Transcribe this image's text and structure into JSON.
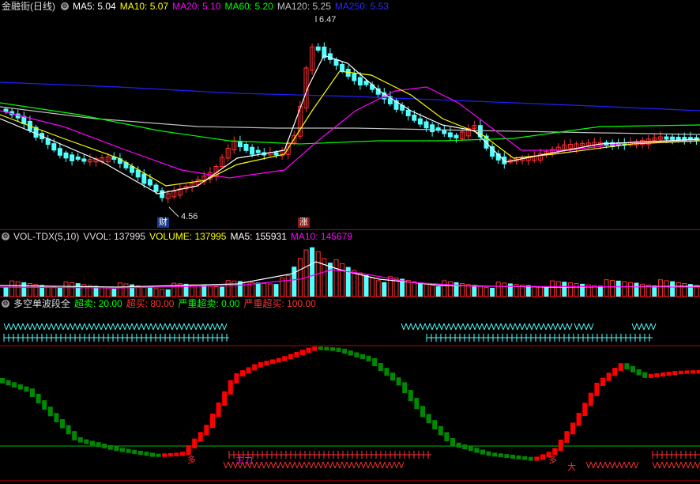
{
  "colors": {
    "up": "#ff3232",
    "down": "#54ffff",
    "ma5": "#ffffff",
    "ma10": "#ffff00",
    "ma20": "#ff00ff",
    "ma60": "#00ff00",
    "ma120": "#c0c0c0",
    "ma250": "#2020ff",
    "bull": "#ff0000",
    "bear": "#008800",
    "grid": "#c00000"
  },
  "price_pane": {
    "stock_name": "金融街(日线)",
    "ma_labels": [
      {
        "text": "MA5: 5.04",
        "color": "#ffffff"
      },
      {
        "text": "MA10: 5.07",
        "color": "#ffff00"
      },
      {
        "text": "MA20: 5.10",
        "color": "#ff00ff"
      },
      {
        "text": "MA60: 5.20",
        "color": "#00ff00"
      },
      {
        "text": "MA120: 5.25",
        "color": "#c0c0c0"
      },
      {
        "text": "MA250: 5.53",
        "color": "#2020ff"
      }
    ],
    "high_label": "6.47",
    "low_label": "4.56",
    "badge_cai": "财",
    "badge_zhang": "涨"
  },
  "volume_pane": {
    "labels": [
      {
        "text": "VOL-TDX(5,10)",
        "color": "#dddddd"
      },
      {
        "text": "VVOL: 137995",
        "color": "#dddddd"
      },
      {
        "text": "VOLUME: 137995",
        "color": "#ffff00"
      },
      {
        "text": "MA5: 155931",
        "color": "#ffffff"
      },
      {
        "text": "MA10: 145679",
        "color": "#ff00ff"
      }
    ]
  },
  "wave_pane": {
    "labels": [
      {
        "text": "多空单波段全",
        "color": "#dddddd"
      },
      {
        "text": "超卖: 20.00",
        "color": "#00ff00"
      },
      {
        "text": "超买: 80.00",
        "color": "#ff3232"
      },
      {
        "text": "严重超卖: 0.00",
        "color": "#00ff00"
      },
      {
        "text": "严重超买: 100.00",
        "color": "#ff3232"
      }
    ],
    "marker_duo_1": "多",
    "marker_zhuli": "主力",
    "marker_duo_2": "多",
    "marker_da": "大"
  }
}
